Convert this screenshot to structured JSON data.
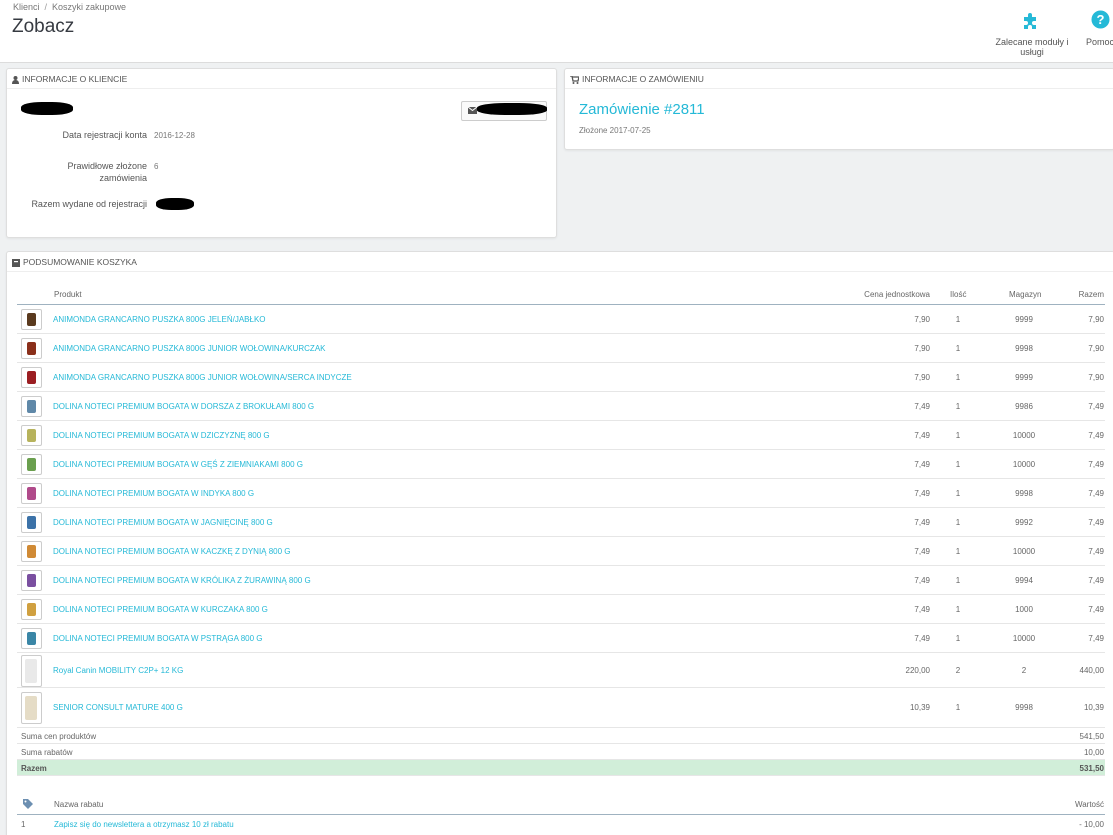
{
  "breadcrumb": {
    "item1": "Klienci",
    "separator": "/",
    "item2": "Koszyki zakupowe"
  },
  "page": {
    "title": "Zobacz"
  },
  "toolbar": {
    "modules_label": "Zalecane moduły i usługi",
    "help_label": "Pomoc",
    "modules_icon": "puzzle-icon",
    "help_icon": "help-icon"
  },
  "customer_panel": {
    "heading": "INFORMACJE O KLIENCIE",
    "reg_label": "Data rejestracji konta",
    "reg_value": "2016-12-28",
    "orders_label_1": "Prawidłowe złożone",
    "orders_label_2": "zamówienia",
    "orders_value": "6",
    "spent_label": "Razem wydane od rejestracji"
  },
  "order_panel": {
    "heading": "INFORMACJE O ZAMÓWIENIU",
    "order_link": "Zamówienie #2811",
    "placed": "Złożone 2017-07-25"
  },
  "cart": {
    "heading": "PODSUMOWANIE KOSZYKA",
    "columns": {
      "product": "Produkt",
      "unit_price": "Cena jednostkowa",
      "qty": "Ilość",
      "stock": "Magazyn",
      "total": "Razem"
    },
    "rows": [
      {
        "name": "ANIMONDA GRANCARNO PUSZKA 800G JELEŃ/JABŁKO",
        "price": "7,90",
        "qty": "1",
        "stock": "9999",
        "total": "7,90"
      },
      {
        "name": "ANIMONDA GRANCARNO PUSZKA 800G JUNIOR WOŁOWINA/KURCZAK",
        "price": "7,90",
        "qty": "1",
        "stock": "9998",
        "total": "7,90"
      },
      {
        "name": "ANIMONDA GRANCARNO PUSZKA 800G JUNIOR WOŁOWINA/SERCA INDYCZE",
        "price": "7,90",
        "qty": "1",
        "stock": "9999",
        "total": "7,90"
      },
      {
        "name": "DOLINA NOTECI PREMIUM BOGATA W DORSZA Z BROKUŁAMI 800 G",
        "price": "7,49",
        "qty": "1",
        "stock": "9986",
        "total": "7,49"
      },
      {
        "name": "DOLINA NOTECI PREMIUM BOGATA W DZICZYZNĘ 800 G",
        "price": "7,49",
        "qty": "1",
        "stock": "10000",
        "total": "7,49"
      },
      {
        "name": "DOLINA NOTECI PREMIUM BOGATA W GĘŚ Z ZIEMNIAKAMI 800 G",
        "price": "7,49",
        "qty": "1",
        "stock": "10000",
        "total": "7,49"
      },
      {
        "name": "DOLINA NOTECI PREMIUM BOGATA W INDYKA 800 G",
        "price": "7,49",
        "qty": "1",
        "stock": "9998",
        "total": "7,49"
      },
      {
        "name": "DOLINA NOTECI PREMIUM BOGATA W JAGNIĘCINĘ 800 G",
        "price": "7,49",
        "qty": "1",
        "stock": "9992",
        "total": "7,49"
      },
      {
        "name": "DOLINA NOTECI PREMIUM BOGATA W KACZKĘ Z DYNIĄ 800 G",
        "price": "7,49",
        "qty": "1",
        "stock": "10000",
        "total": "7,49"
      },
      {
        "name": "DOLINA NOTECI PREMIUM BOGATA W KRÓLIKA Z ŻURAWINĄ 800 G",
        "price": "7,49",
        "qty": "1",
        "stock": "9994",
        "total": "7,49"
      },
      {
        "name": "DOLINA NOTECI PREMIUM BOGATA W KURCZAKA 800 G",
        "price": "7,49",
        "qty": "1",
        "stock": "1000",
        "total": "7,49"
      },
      {
        "name": "DOLINA NOTECI PREMIUM BOGATA W PSTRĄGA 800 G",
        "price": "7,49",
        "qty": "1",
        "stock": "10000",
        "total": "7,49"
      },
      {
        "name": "Royal Canin MOBILITY C2P+ 12 KG",
        "price": "220,00",
        "qty": "2",
        "stock": "2",
        "total": "440,00"
      },
      {
        "name": "SENIOR CONSULT MATURE 400 G",
        "price": "10,39",
        "qty": "1",
        "stock": "9998",
        "total": "10,39"
      }
    ],
    "sum_products_label": "Suma cen produktów",
    "sum_products_value": "541,50",
    "sum_discounts_label": "Suma rabatów",
    "sum_discounts_value": "10,00",
    "total_label": "Razem",
    "total_value": "531,50"
  },
  "discounts": {
    "col_name": "Nazwa rabatu",
    "col_value": "Wartość",
    "rows": [
      {
        "id": "1",
        "name": "Zapisz się do newslettera a otrzymasz 10 zł rabatu",
        "value": "- 10,00"
      }
    ]
  },
  "colors": {
    "accent": "#25b9d7",
    "total_row": "#d1eed9"
  }
}
